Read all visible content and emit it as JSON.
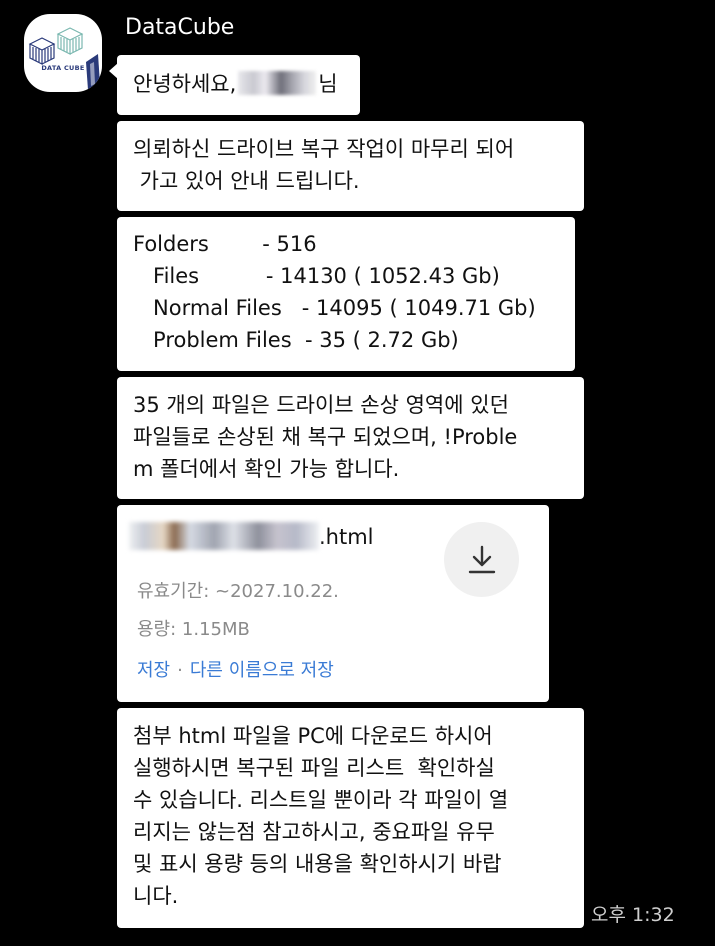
{
  "sender": {
    "name": "DataCube",
    "logo_text": "DATA CUBE"
  },
  "messages": {
    "greeting_prefix": "안녕하세요,",
    "greeting_suffix": "님",
    "notice": [
      "의뢰하신 드라이브 복구 작업이 마무리 되어",
      " 가고 있어 안내 드립니다."
    ],
    "stats": [
      "Folders        - 516",
      "   Files          - 14130 ( 1052.43 Gb)",
      "   Normal Files   - 14095 ( 1049.71 Gb)",
      "   Problem Files  - 35 ( 2.72 Gb)"
    ],
    "problem_note": [
      "35 개의 파일은 드라이브 손상 영역에 있던",
      "파일들로 손상된 채 복구 되었으며, !Proble",
      "m 폴더에서 확인 가능 합니다."
    ],
    "instructions": [
      "첨부 html 파일을 PC에 다운로드 하시어",
      "실행하시면 복구된 파일 리스트  확인하실",
      "수 있습니다. 리스트일 뿐이라 각 파일이 열",
      "리지는 않는점 참고하시고, 중요파일 유무",
      "및 표시 용량 등의 내용을 확인하시기 바랍",
      "니다."
    ]
  },
  "attachment": {
    "extension": ".html",
    "expiry": "유효기간: ~2027.10.22.",
    "size": "용량: 1.15MB",
    "save_label": "저장",
    "save_as_label": "다른 이름으로 저장",
    "icon": "download-icon"
  },
  "timestamp": "오후 1:32"
}
